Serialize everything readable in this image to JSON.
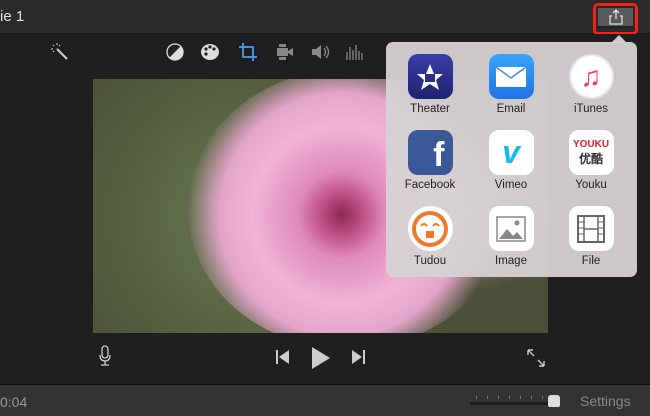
{
  "window": {
    "title": "ie 1"
  },
  "toolbar": {
    "tools": [
      "magic-wand",
      "color-balance",
      "color-correction",
      "crop",
      "stabilization",
      "volume",
      "noise-reduction"
    ]
  },
  "share_menu": {
    "items": [
      {
        "label": "Theater",
        "color": "#2b2f8f"
      },
      {
        "label": "Email",
        "color": "#2a8cf0"
      },
      {
        "label": "iTunes",
        "color": "#ffffff"
      },
      {
        "label": "Facebook",
        "color": "#3b5998"
      },
      {
        "label": "Vimeo",
        "color": "#ffffff"
      },
      {
        "label": "Youku",
        "color": "#ffffff"
      },
      {
        "label": "Tudou",
        "color": "#ffffff"
      },
      {
        "label": "Image",
        "color": "#ffffff"
      },
      {
        "label": "File",
        "color": "#ffffff"
      }
    ]
  },
  "youku_text": "YOUKU",
  "youku_sub": "优酷",
  "bottom": {
    "time": "0:04",
    "settings": "Settings",
    "zoom_level": 1.0
  }
}
